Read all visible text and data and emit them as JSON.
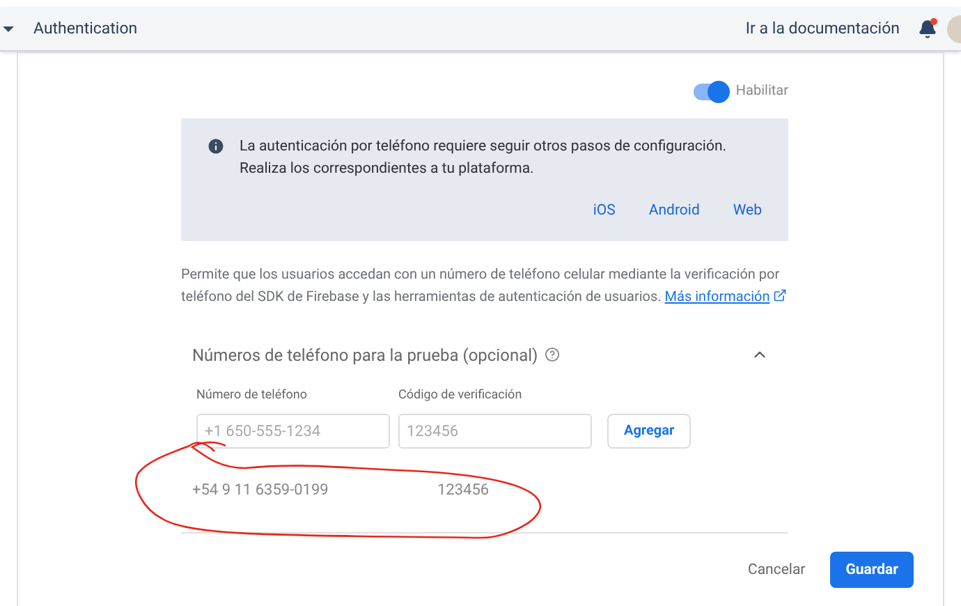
{
  "header": {
    "title": "Authentication",
    "docs_link": "Ir a la documentación",
    "notification_dot": true
  },
  "toggle": {
    "label": "Habilitar",
    "on": true
  },
  "info": {
    "text": "La autenticación por teléfono requiere seguir otros pasos de configuración. Realiza los correspondientes a tu plataforma.",
    "links": [
      "iOS",
      "Android",
      "Web"
    ]
  },
  "description": {
    "text": "Permite que los usuarios accedan con un número de teléfono celular mediante la verificación por teléfono del SDK de Firebase y las herramientas de autenticación de usuarios.",
    "link": "Más información"
  },
  "test_numbers": {
    "title": "Números de teléfono para la prueba (opcional)",
    "expanded": true,
    "phone_field": {
      "label": "Número de teléfono",
      "placeholder": "+1 650-555-1234"
    },
    "code_field": {
      "label": "Código de verificación",
      "placeholder": "123456"
    },
    "add_button": "Agregar",
    "rows": [
      {
        "phone": "+54 9 11 6359-0199",
        "code": "123456"
      }
    ]
  },
  "buttons": {
    "cancel": "Cancelar",
    "save": "Guardar"
  }
}
